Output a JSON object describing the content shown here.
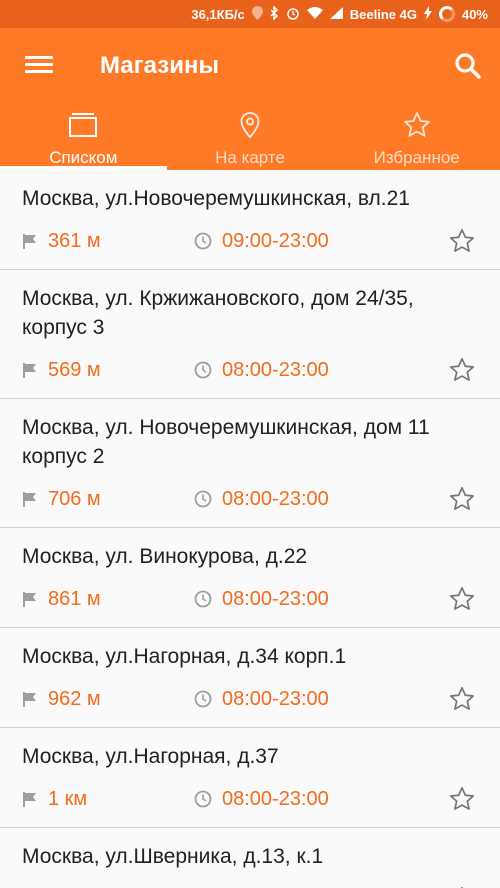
{
  "status_bar": {
    "speed": "36,1КБ/с",
    "carrier": "Beeline 4G",
    "battery": "40%"
  },
  "app_bar": {
    "title": "Магазины",
    "menu_icon": "hamburger-menu-icon",
    "search_icon": "search-icon"
  },
  "tabs": [
    {
      "label": "Списком",
      "icon": "list-card-icon",
      "active": true
    },
    {
      "label": "На карте",
      "icon": "map-pin-icon",
      "active": false
    },
    {
      "label": "Избранное",
      "icon": "star-icon",
      "active": false
    }
  ],
  "stores": [
    {
      "address": "Москва, ул.Новочеремушкинская, вл.21",
      "distance": "361 м",
      "hours": "09:00-23:00"
    },
    {
      "address": "Москва, ул. Кржижановского, дом 24/35, корпус 3",
      "distance": "569 м",
      "hours": "08:00-23:00"
    },
    {
      "address": "Москва, ул. Новочеремушкинская, дом 11 корпус 2",
      "distance": "706 м",
      "hours": "08:00-23:00"
    },
    {
      "address": "Москва, ул. Винокурова, д.22",
      "distance": "861 м",
      "hours": "08:00-23:00"
    },
    {
      "address": "Москва, ул.Нагорная, д.34 корп.1",
      "distance": "962 м",
      "hours": "08:00-23:00"
    },
    {
      "address": "Москва, ул.Нагорная, д.37",
      "distance": "1 км",
      "hours": "08:00-23:00"
    },
    {
      "address": "Москва, ул.Шверника, д.13, к.1",
      "distance": "",
      "hours": ""
    }
  ],
  "colors": {
    "status_bar": "#e8621b",
    "app_bar": "#ff7a27",
    "accent_text": "#f26c1c"
  }
}
